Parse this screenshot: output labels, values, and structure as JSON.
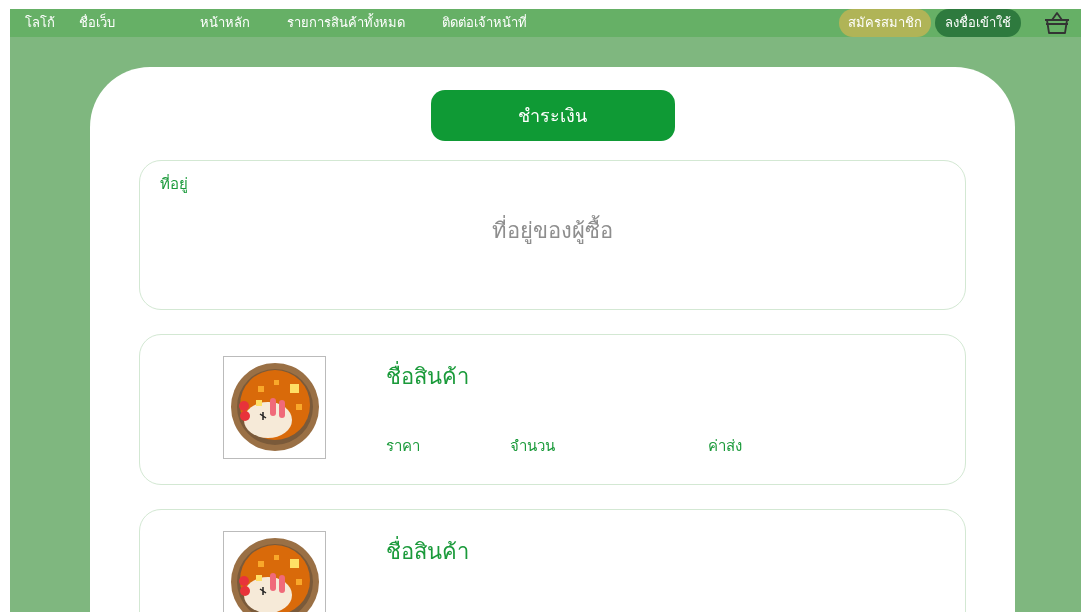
{
  "navbar": {
    "logo": "โลโก้",
    "site_name": "ชื่อเว็บ",
    "links": [
      {
        "label": "หน้าหลัก"
      },
      {
        "label": "รายการสินค้าทั้งหมด"
      },
      {
        "label": "ติดต่อเจ้าหน้าที่"
      }
    ],
    "register_button": "สมัครสมาชิก",
    "login_button": "ลงชื่อเข้าใช้"
  },
  "pay_button": "ชำระเงิน",
  "address": {
    "label": "ที่อยู่",
    "placeholder": "ที่อยู่ของผู้ซื้อ"
  },
  "products": [
    {
      "name": "ชื่อสินค้า",
      "price_label": "ราคา",
      "quantity_label": "จำนวน",
      "shipping_label": "ค่าส่ง"
    },
    {
      "name": "ชื่อสินค้า"
    }
  ]
}
